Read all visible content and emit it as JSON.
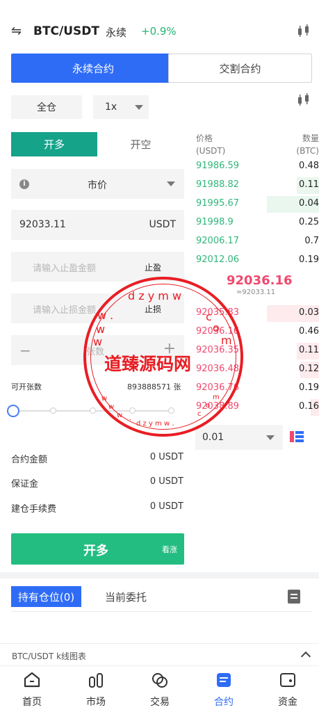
{
  "header": {
    "swap_icon": "swap-arrows-icon",
    "pair": "BTC/USDT",
    "contract_type": "永续",
    "change": "+0.9%"
  },
  "contract_tabs": {
    "perpetual": "永续合约",
    "delivery": "交割合约"
  },
  "margin_mode": "全仓",
  "leverage": "1x",
  "side_tabs": {
    "long": "开多",
    "short": "开空"
  },
  "order_type": "市价",
  "price": {
    "value": "92033.11",
    "unit": "USDT"
  },
  "take_profit": {
    "placeholder": "请输入止盈金额",
    "tag": "止盈"
  },
  "stop_loss": {
    "placeholder": "请输入止损金额",
    "tag": "止损"
  },
  "quantity": {
    "placeholder": "张数",
    "minus": "−",
    "plus": "+"
  },
  "available": {
    "label": "可开张数",
    "value": "893888571 张"
  },
  "slider": {
    "level": 0
  },
  "summary": [
    {
      "label": "合约金额",
      "value": "0 USDT"
    },
    {
      "label": "保证金",
      "value": "0 USDT"
    },
    {
      "label": "建仓手续费",
      "value": "0 USDT"
    }
  ],
  "buy_button": {
    "label": "开多",
    "sub": "看涨"
  },
  "orderbook": {
    "price_header": "价格",
    "price_unit": "(USDT)",
    "qty_header": "数量",
    "qty_unit": "(BTC)",
    "bids": [
      {
        "price": "91986.59",
        "qty": "0.48",
        "depth": 0
      },
      {
        "price": "91988.82",
        "qty": "0.11",
        "depth": 0.43
      },
      {
        "price": "91995.67",
        "qty": "0.04",
        "depth": 1.0
      },
      {
        "price": "91998.9",
        "qty": "0.25",
        "depth": 0
      },
      {
        "price": "92006.17",
        "qty": "0.7",
        "depth": 0
      },
      {
        "price": "92012.06",
        "qty": "0.19",
        "depth": 0
      }
    ],
    "mid_price": "92036.16",
    "mid_ref": "≈92033.11",
    "asks": [
      {
        "price": "92035.83",
        "qty": "0.03",
        "depth": 1.0
      },
      {
        "price": "92036.16",
        "qty": "0.46",
        "depth": 0
      },
      {
        "price": "92036.35",
        "qty": "0.11",
        "depth": 0.43
      },
      {
        "price": "92036.48",
        "qty": "0.12",
        "depth": 0.36
      },
      {
        "price": "92036.76",
        "qty": "0.19",
        "depth": 0
      },
      {
        "price": "92038.89",
        "qty": "0.16",
        "depth": 0.16
      }
    ],
    "precision": "0.01"
  },
  "positions": {
    "holding_tab": "持有仓位(0)",
    "orders_tab": "当前委托"
  },
  "kline_bar": "BTC/USDT k线图表",
  "nav": [
    {
      "label": "首页",
      "icon": "home-icon"
    },
    {
      "label": "市场",
      "icon": "market-icon"
    },
    {
      "label": "交易",
      "icon": "trade-icon"
    },
    {
      "label": "合约",
      "icon": "contract-icon"
    },
    {
      "label": "资金",
      "icon": "wallet-icon"
    }
  ],
  "watermark": {
    "text": "道臻源码网",
    "url": "www.dzym.com"
  },
  "colors": {
    "accent": "#2f6cf6",
    "green": "#2fb67a",
    "red": "#f0486e",
    "buy": "#23bd82",
    "open_long": "#15a38a"
  }
}
